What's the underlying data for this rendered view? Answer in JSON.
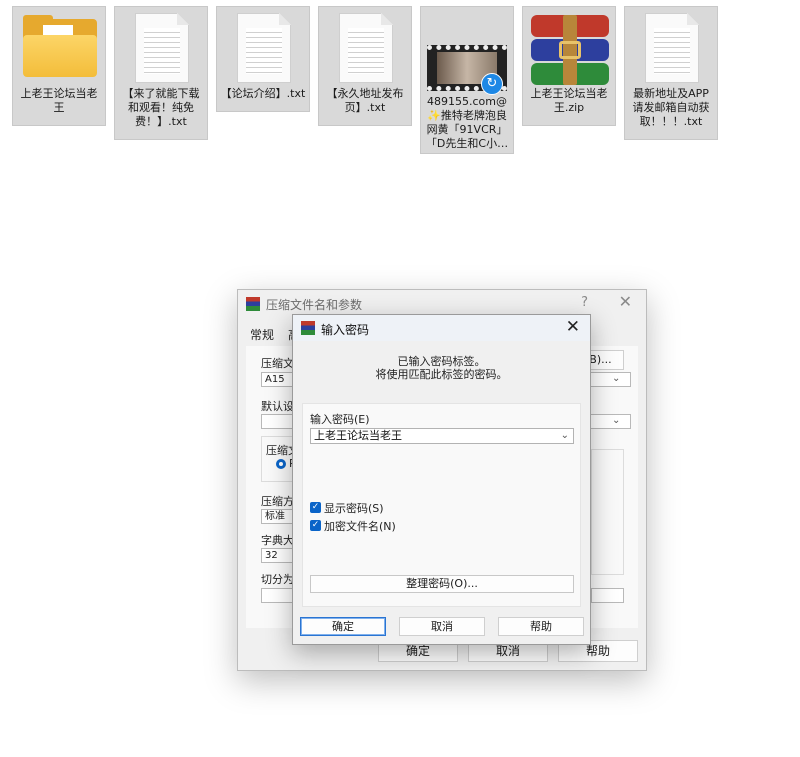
{
  "desktop": {
    "files": [
      {
        "name": "上老王论坛当老王",
        "type": "folder"
      },
      {
        "name": "【来了就能下载和观看！纯免费！】.txt",
        "type": "txt"
      },
      {
        "name": "【论坛介绍】.txt",
        "type": "txt"
      },
      {
        "name": "【永久地址发布页】.txt",
        "type": "txt"
      },
      {
        "name": "489155.com@✨推特老牌泡良网黄「91VCR」「D先生和C小…",
        "type": "video"
      },
      {
        "name": "上老王论坛当老王.zip",
        "type": "rar"
      },
      {
        "name": "最新地址及APP请发邮箱自动获取！！！.txt",
        "type": "txt"
      }
    ]
  },
  "back_window": {
    "title": "压缩文件名和参数",
    "help_glyph": "?",
    "close_glyph": "✕",
    "tabs": [
      "常规",
      "高"
    ],
    "archive_name_label": "压缩文件",
    "archive_name_value": "A15",
    "browse_label": "(B)...",
    "default_profile_label": "默认设置",
    "format_group_label": "压缩文",
    "format_radio_label": "R",
    "method_label": "压缩方式",
    "method_value": "标准",
    "dict_label": "字典大小",
    "dict_value": "32",
    "split_label": "切分为分",
    "ok": "确定",
    "cancel": "取消",
    "help": "帮助"
  },
  "password_dialog": {
    "title": "输入密码",
    "close_glyph": "✕",
    "message_line1": "已输入密码标签。",
    "message_line2": "将使用匹配此标签的密码。",
    "password_label": "输入密码(E)",
    "password_value": "上老王论坛当老王",
    "show_password_label": "显示密码(S)",
    "show_password_checked": true,
    "encrypt_names_label": "加密文件名(N)",
    "encrypt_names_checked": true,
    "organize_label": "整理密码(O)...",
    "ok": "确定",
    "cancel": "取消",
    "help": "帮助"
  }
}
